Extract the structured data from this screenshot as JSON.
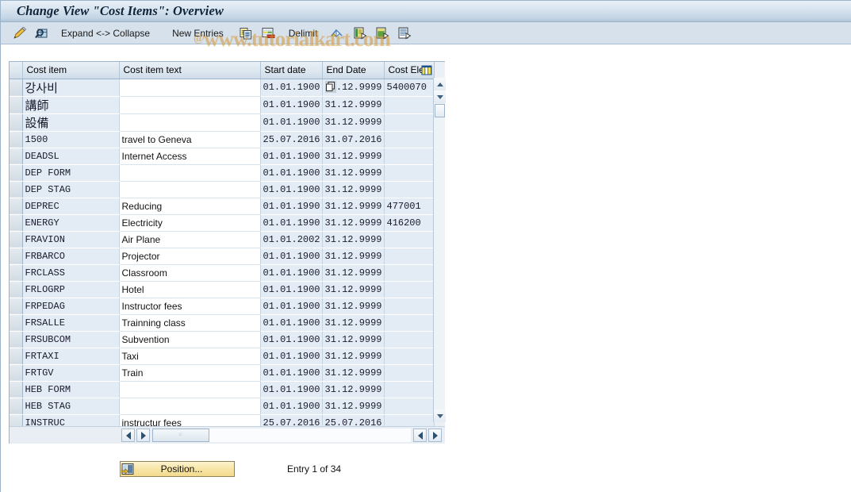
{
  "window": {
    "title": "Change View \"Cost Items\": Overview"
  },
  "watermark": {
    "text": "www.tutorialkart.com",
    "at": "@"
  },
  "toolbar": {
    "items": [
      {
        "name": "display-change-icon",
        "label": "",
        "icon": "pencil-display-change-icon"
      },
      {
        "name": "select-layout-icon",
        "label": "",
        "icon": "magnifier-grid-icon"
      },
      {
        "name": "expand-collapse-button",
        "label": "Expand <-> Collapse",
        "icon": ""
      },
      {
        "name": "new-entries-button",
        "label": "New Entries",
        "icon": ""
      },
      {
        "name": "copy-as-icon",
        "label": "",
        "icon": "copy-icon"
      },
      {
        "name": "delete-icon",
        "label": "",
        "icon": "delete-row-icon"
      },
      {
        "name": "delimit-button",
        "label": "Delimit",
        "icon": ""
      },
      {
        "name": "undo-icon",
        "label": "",
        "icon": "undo-arrow-icon"
      },
      {
        "name": "previous-entry-icon",
        "label": "",
        "icon": "prev-page-icon"
      },
      {
        "name": "next-entry-icon",
        "label": "",
        "icon": "next-page-icon"
      },
      {
        "name": "variable-list-icon",
        "label": "",
        "icon": "list-page-icon"
      }
    ]
  },
  "table": {
    "columns": [
      {
        "key": "select",
        "label": ""
      },
      {
        "key": "cost_item",
        "label": "Cost item"
      },
      {
        "key": "cost_item_text",
        "label": "Cost item text"
      },
      {
        "key": "start_date",
        "label": "Start date"
      },
      {
        "key": "end_date",
        "label": "End Date"
      },
      {
        "key": "cost_element",
        "label": "Cost Ele"
      }
    ],
    "rows": [
      {
        "cost_item": "강사비",
        "cjk": true,
        "cost_item_text": "",
        "start_date": "01.01.1900",
        "end_date": "31.12.9999",
        "cost_element": "5400070",
        "focused": true
      },
      {
        "cost_item": "講師",
        "cjk": true,
        "cost_item_text": "",
        "start_date": "01.01.1900",
        "end_date": "31.12.9999",
        "cost_element": ""
      },
      {
        "cost_item": "設備",
        "cjk": true,
        "cost_item_text": "",
        "start_date": "01.01.1900",
        "end_date": "31.12.9999",
        "cost_element": ""
      },
      {
        "cost_item": "1500",
        "cost_item_text": "travel to Geneva",
        "start_date": "25.07.2016",
        "end_date": "31.07.2016",
        "cost_element": ""
      },
      {
        "cost_item": "DEADSL",
        "cost_item_text": "Internet Access",
        "start_date": "01.01.1900",
        "end_date": "31.12.9999",
        "cost_element": ""
      },
      {
        "cost_item": "DEP FORM",
        "cost_item_text": "",
        "start_date": "01.01.1900",
        "end_date": "31.12.9999",
        "cost_element": ""
      },
      {
        "cost_item": "DEP STAG",
        "cost_item_text": "",
        "start_date": "01.01.1900",
        "end_date": "31.12.9999",
        "cost_element": ""
      },
      {
        "cost_item": "DEPREC",
        "cost_item_text": "Reducing",
        "start_date": "01.01.1990",
        "end_date": "31.12.9999",
        "cost_element": "477001"
      },
      {
        "cost_item": "ENERGY",
        "cost_item_text": "Electricity",
        "start_date": "01.01.1990",
        "end_date": "31.12.9999",
        "cost_element": "416200"
      },
      {
        "cost_item": "FRAVION",
        "cost_item_text": "Air Plane",
        "start_date": "01.01.2002",
        "end_date": "31.12.9999",
        "cost_element": ""
      },
      {
        "cost_item": "FRBARCO",
        "cost_item_text": "Projector",
        "start_date": "01.01.1900",
        "end_date": "31.12.9999",
        "cost_element": ""
      },
      {
        "cost_item": "FRCLASS",
        "cost_item_text": "Classroom",
        "start_date": "01.01.1900",
        "end_date": "31.12.9999",
        "cost_element": ""
      },
      {
        "cost_item": "FRLOGRP",
        "cost_item_text": "Hotel",
        "start_date": "01.01.1900",
        "end_date": "31.12.9999",
        "cost_element": ""
      },
      {
        "cost_item": "FRPEDAG",
        "cost_item_text": "Instructor fees",
        "start_date": "01.01.1900",
        "end_date": "31.12.9999",
        "cost_element": ""
      },
      {
        "cost_item": "FRSALLE",
        "cost_item_text": "Trainning class",
        "start_date": "01.01.1900",
        "end_date": "31.12.9999",
        "cost_element": ""
      },
      {
        "cost_item": "FRSUBCOM",
        "cost_item_text": "Subvention",
        "start_date": "01.01.1900",
        "end_date": "31.12.9999",
        "cost_element": ""
      },
      {
        "cost_item": "FRTAXI",
        "cost_item_text": "Taxi",
        "start_date": "01.01.1900",
        "end_date": "31.12.9999",
        "cost_element": ""
      },
      {
        "cost_item": "FRTGV",
        "cost_item_text": "Train",
        "start_date": "01.01.1900",
        "end_date": "31.12.9999",
        "cost_element": ""
      },
      {
        "cost_item": "HEB FORM",
        "cost_item_text": "",
        "start_date": "01.01.1900",
        "end_date": "31.12.9999",
        "cost_element": ""
      },
      {
        "cost_item": "HEB STAG",
        "cost_item_text": "",
        "start_date": "01.01.1900",
        "end_date": "31.12.9999",
        "cost_element": ""
      },
      {
        "cost_item": "INSTRUC",
        "cost_item_text": "instructur fees",
        "start_date": "25.07.2016",
        "end_date": "25.07.2016",
        "cost_element": ""
      }
    ]
  },
  "footer": {
    "position_label": "Position...",
    "entry_status": "Entry 1 of 34"
  },
  "colors": {
    "title_bar_top": "#e8f0f7",
    "title_bar_bottom": "#aec4d8",
    "toolbar_bg": "#d6e1eb",
    "key_cell_bg": "#e3ecf4",
    "text_cell_bg": "#ffffff",
    "button_accent": "#f3da8e",
    "watermark": "#d6922a"
  }
}
